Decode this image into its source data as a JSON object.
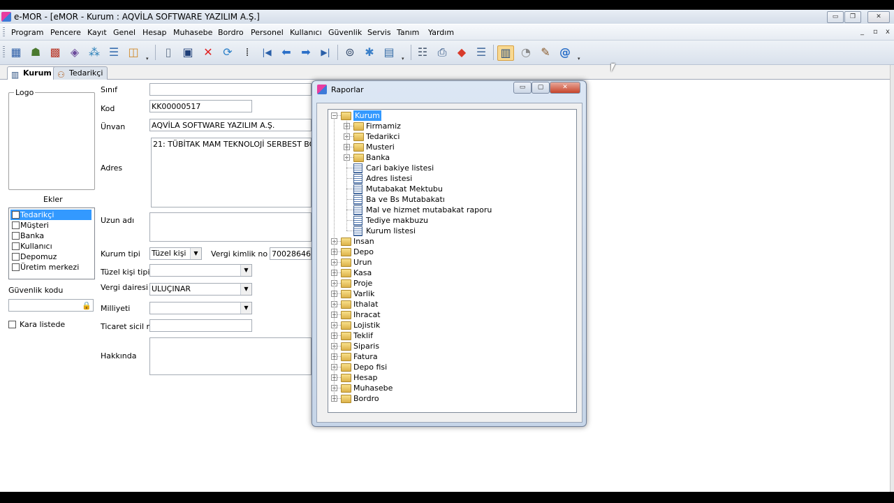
{
  "window": {
    "title": "e-MOR - [eMOR - Kurum : AQVİLA SOFTWARE YAZILIM A.Ş.]",
    "min_glyph": "▭",
    "max_glyph": "❐",
    "close_glyph": "✕"
  },
  "menu": {
    "items": [
      "Program",
      "Pencere",
      "Kayıt",
      "Genel",
      "Hesap",
      "Muhasebe",
      "Bordro",
      "Personel",
      "Kullanıcı",
      "Güvenlik",
      "Servis",
      "Tanım",
      "Yardım"
    ],
    "mdi_min": "_",
    "mdi_restore": "▫",
    "mdi_close": "x"
  },
  "toolbar": {
    "icons": [
      "folder-stack-icon",
      "users-icon",
      "grid-icon",
      "diamond-icon",
      "network-icon",
      "list-edit-icon",
      "box-icon",
      "new-document-icon",
      "save-icon",
      "delete-icon",
      "refresh-icon",
      "binoculars-icon",
      "first-record-icon",
      "previous-record-icon",
      "next-record-icon",
      "last-record-icon",
      "print-preview-icon",
      "gear-icon",
      "window-icon",
      "report-icon",
      "printer-icon",
      "chart-icon",
      "list-icon",
      "layout-icon",
      "clock-icon",
      "pen-icon",
      "email-icon"
    ],
    "glyphs": [
      "▦",
      "☗",
      "▩",
      "◈",
      "⁂",
      "☰",
      "◫",
      "▯",
      "▣",
      "✕",
      "⟳",
      "⁞",
      "|◀",
      "⬅",
      "➡",
      "▶|",
      "⊚",
      "✱",
      "▤",
      "☷",
      "⎙",
      "◆",
      "☰",
      "▥",
      "◔",
      "✎",
      "@"
    ],
    "drop_glyph": "▾"
  },
  "tabs": [
    {
      "label": "Kurum",
      "icon": "▥"
    },
    {
      "label": "Tedarikçi",
      "icon": "⚇"
    }
  ],
  "left_panel": {
    "logo_label": "Logo",
    "ekler_label": "Ekler",
    "ekler_items": [
      {
        "label": "Tedarikçi",
        "checked": true
      },
      {
        "label": "Müşteri",
        "checked": false
      },
      {
        "label": "Banka",
        "checked": false
      },
      {
        "label": "Kullanıcı",
        "checked": false
      },
      {
        "label": "Depomuz",
        "checked": false
      },
      {
        "label": "Üretim merkezi",
        "checked": false
      }
    ],
    "guvenlik_kodu_label": "Güvenlik kodu",
    "guvenlik_kodu_value": "",
    "lock_glyph": "🔒",
    "kara_listede_label": "Kara listede",
    "check_glyph": "✔"
  },
  "form": {
    "sinif_label": "Sınıf",
    "sinif_value": "",
    "kod_label": "Kod",
    "kod_value": "KK00000517",
    "unvan_label": "Ünvan",
    "unvan_value": "AQVİLA SOFTWARE YAZILIM A.Ş.",
    "adres_label": "Adres",
    "adres_value": "21: TÜBİTAK MAM TEKNOLOJİ SERBEST BÖLGE",
    "uzun_adi_label": "Uzun adı",
    "uzun_adi_value": "",
    "kurum_tipi_label": "Kurum tipi",
    "kurum_tipi_value": "Tüzel kişi",
    "vergi_kimlik_label": "Vergi kimlik no",
    "vergi_kimlik_value": "700286465",
    "tuzel_kisi_tipi_label": "Tüzel kişi tipi",
    "tuzel_kisi_tipi_value": "",
    "vergi_dairesi_label": "Vergi dairesi",
    "vergi_dairesi_value": "ULUÇINAR",
    "milliyeti_label": "Milliyeti",
    "milliyeti_value": "",
    "ticaret_sicil_label": "Ticaret sicil no",
    "ticaret_sicil_value": "",
    "hakkinda_label": "Hakkında",
    "hakkinda_value": "",
    "combo_arrow": "▼"
  },
  "dialog": {
    "title": "Raporlar",
    "min_glyph": "▭",
    "max_glyph": "▢",
    "close_glyph": "✕",
    "tree": [
      {
        "label": "Kurum",
        "level": 0,
        "type": "folder",
        "expander": "−",
        "selected": true
      },
      {
        "label": "Firmamiz",
        "level": 1,
        "type": "folder",
        "expander": "+"
      },
      {
        "label": "Tedarikci",
        "level": 1,
        "type": "folder",
        "expander": "+"
      },
      {
        "label": "Musteri",
        "level": 1,
        "type": "folder",
        "expander": "+"
      },
      {
        "label": "Banka",
        "level": 1,
        "type": "folder",
        "expander": "+"
      },
      {
        "label": "Cari bakiye listesi",
        "level": 1,
        "type": "report"
      },
      {
        "label": "Adres listesi",
        "level": 1,
        "type": "report"
      },
      {
        "label": "Mutabakat Mektubu",
        "level": 1,
        "type": "report"
      },
      {
        "label": "Ba ve Bs Mutabakatı",
        "level": 1,
        "type": "report"
      },
      {
        "label": "Mal ve hizmet mutabakat raporu",
        "level": 1,
        "type": "report"
      },
      {
        "label": "Tediye makbuzu",
        "level": 1,
        "type": "report"
      },
      {
        "label": "Kurum listesi",
        "level": 1,
        "type": "report"
      },
      {
        "label": "Insan",
        "level": 0,
        "type": "folder",
        "expander": "+"
      },
      {
        "label": "Depo",
        "level": 0,
        "type": "folder",
        "expander": "+"
      },
      {
        "label": "Urun",
        "level": 0,
        "type": "folder",
        "expander": "+"
      },
      {
        "label": "Kasa",
        "level": 0,
        "type": "folder",
        "expander": "+"
      },
      {
        "label": "Proje",
        "level": 0,
        "type": "folder",
        "expander": "+"
      },
      {
        "label": "Varlik",
        "level": 0,
        "type": "folder",
        "expander": "+"
      },
      {
        "label": "Ithalat",
        "level": 0,
        "type": "folder",
        "expander": "+"
      },
      {
        "label": "Ihracat",
        "level": 0,
        "type": "folder",
        "expander": "+"
      },
      {
        "label": "Lojistik",
        "level": 0,
        "type": "folder",
        "expander": "+"
      },
      {
        "label": "Teklif",
        "level": 0,
        "type": "folder",
        "expander": "+"
      },
      {
        "label": "Siparis",
        "level": 0,
        "type": "folder",
        "expander": "+"
      },
      {
        "label": "Fatura",
        "level": 0,
        "type": "folder",
        "expander": "+"
      },
      {
        "label": "Depo fisi",
        "level": 0,
        "type": "folder",
        "expander": "+"
      },
      {
        "label": "Hesap",
        "level": 0,
        "type": "folder",
        "expander": "+"
      },
      {
        "label": "Muhasebe",
        "level": 0,
        "type": "folder",
        "expander": "+"
      },
      {
        "label": "Bordro",
        "level": 0,
        "type": "folder",
        "expander": "+"
      }
    ]
  }
}
